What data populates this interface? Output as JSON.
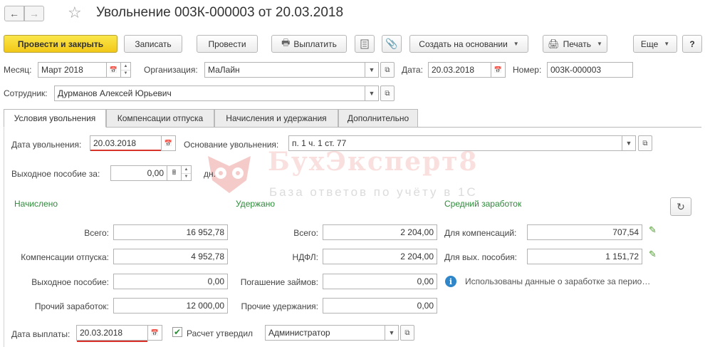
{
  "window": {
    "title": "Увольнение 003К-000003 от 20.03.2018"
  },
  "toolbar": {
    "post_close": "Провести и закрыть",
    "save": "Записать",
    "post": "Провести",
    "pay": "Выплатить",
    "create_based": "Создать на основании",
    "print": "Печать",
    "more": "Еще",
    "help": "?"
  },
  "header": {
    "month_label": "Месяц:",
    "month_value": "Март 2018",
    "org_label": "Организация:",
    "org_value": "МаЛайн",
    "date_label": "Дата:",
    "date_value": "20.03.2018",
    "number_label": "Номер:",
    "number_value": "003К-000003",
    "employee_label": "Сотрудник:",
    "employee_value": "Дурманов Алексей Юрьевич"
  },
  "tabs": [
    {
      "label": "Условия увольнения",
      "active": true
    },
    {
      "label": "Компенсации отпуска",
      "active": false
    },
    {
      "label": "Начисления и удержания",
      "active": false
    },
    {
      "label": "Дополнительно",
      "active": false
    }
  ],
  "conditions": {
    "dismissal_date_label": "Дата увольнения:",
    "dismissal_date_value": "20.03.2018",
    "reason_label": "Основание увольнения:",
    "reason_value": "п. 1 ч. 1 ст. 77",
    "severance_label": "Выходное пособие за:",
    "severance_value": "0,00",
    "severance_unit": "дн."
  },
  "watermark": {
    "brand": "БухЭксперт8",
    "tagline": "База ответов по учёту в 1С"
  },
  "accrued": {
    "heading": "Начислено",
    "total_label": "Всего:",
    "total_value": "16 952,78",
    "vacation_comp_label": "Компенсации отпуска:",
    "vacation_comp_value": "4 952,78",
    "severance_label": "Выходное пособие:",
    "severance_value": "0,00",
    "other_label": "Прочий заработок:",
    "other_value": "12 000,00"
  },
  "withheld": {
    "heading": "Удержано",
    "total_label": "Всего:",
    "total_value": "2 204,00",
    "ndfl_label": "НДФЛ:",
    "ndfl_value": "2 204,00",
    "loans_label": "Погашение займов:",
    "loans_value": "0,00",
    "other_label": "Прочие удержания:",
    "other_value": "0,00"
  },
  "average": {
    "heading": "Средний заработок",
    "comp_label": "Для компенсаций:",
    "comp_value": "707,54",
    "severance_label": "Для вых. пособия:",
    "severance_value": "1 151,72",
    "hint": "Использованы данные о заработке за перио…"
  },
  "footer": {
    "pay_date_label": "Дата выплаты:",
    "pay_date_value": "20.03.2018",
    "approved_label": "Расчет утвердил",
    "approved_checked": true,
    "approver_value": "Администратор"
  }
}
